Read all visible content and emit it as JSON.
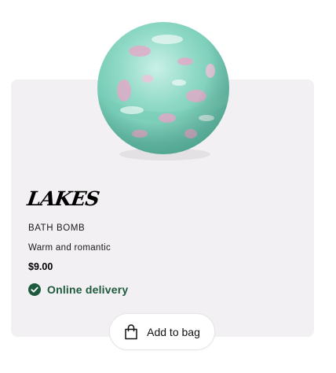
{
  "product": {
    "name": "LAKES",
    "category": "BATH BOMB",
    "description": "Warm and romantic",
    "price": "$9.00",
    "image_icon": "bath-bomb-image"
  },
  "delivery": {
    "label": "Online delivery",
    "icon": "check-circle-icon",
    "color": "#1e5a3e"
  },
  "actions": {
    "add_to_bag_label": "Add to bag",
    "bag_icon": "shopping-bag-icon"
  },
  "colors": {
    "card_background": "#f2f0f2",
    "bomb_base": "#8fd9c6",
    "bomb_accent": "#e6a8c8"
  }
}
